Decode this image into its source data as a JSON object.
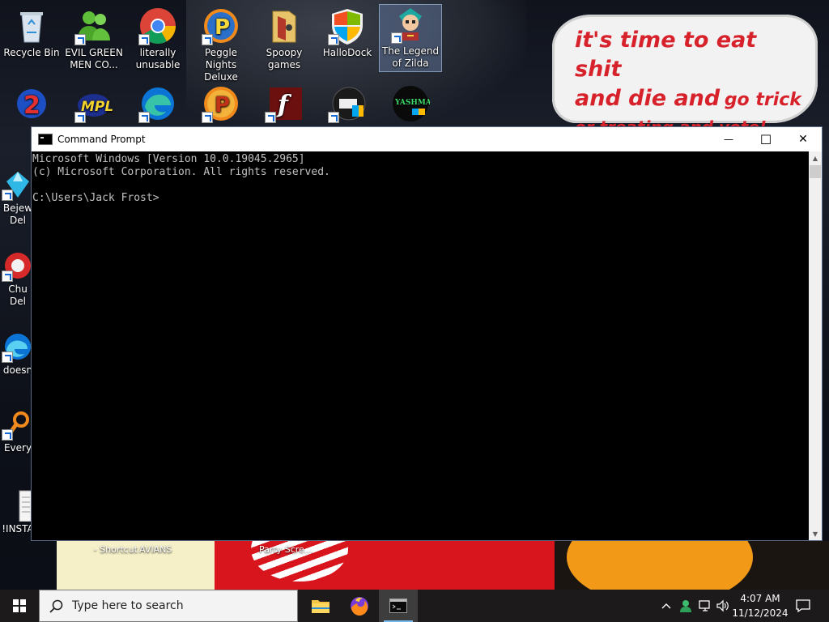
{
  "desktop": {
    "sign": {
      "line1": "it's time to eat shit",
      "line2a": "and die and",
      "line2b": "go trick",
      "line3": "or treating and vote!"
    },
    "icons_row1": [
      {
        "label": "Recycle Bin",
        "icon": "recycle-bin-icon"
      },
      {
        "label": "EVIL GREEN MEN CO...",
        "icon": "people-icon"
      },
      {
        "label": "literally unusable",
        "icon": "chrome-icon"
      },
      {
        "label": "Peggle Nights Deluxe",
        "icon": "peggle-icon"
      },
      {
        "label": "Spoopy games",
        "icon": "folder-icon"
      },
      {
        "label": "HalloDock",
        "icon": "windows-shield-icon"
      },
      {
        "label": "The Legend of Zilda",
        "icon": "game-character-icon"
      }
    ],
    "left_partial_icons": [
      {
        "label": "Bejew Del",
        "icon": "bejeweled-icon"
      },
      {
        "label": "Bejew Del",
        "icon": "bejeweled-icon"
      },
      {
        "label": "Chu Del",
        "icon": "game-icon"
      },
      {
        "label": "doesn",
        "icon": "edge-icon"
      },
      {
        "label": "Every",
        "icon": "search-icon"
      },
      {
        "label": "!INSTA",
        "icon": "document-icon"
      }
    ],
    "bottom_labels": [
      "- Shortcut",
      "AVIANS",
      "Party Scre..."
    ]
  },
  "window": {
    "title": "Command Prompt",
    "minimize": "—",
    "maximize": "☐",
    "close": "✕",
    "console_lines": [
      "Microsoft Windows [Version 10.0.19045.2965]",
      "(c) Microsoft Corporation. All rights reserved.",
      "",
      "C:\\Users\\Jack Frost>"
    ]
  },
  "taskbar": {
    "search_placeholder": "Type here to search",
    "time": "4:07 AM",
    "date": "11/12/2024",
    "apps": [
      "file-explorer-icon",
      "firefox-icon",
      "command-prompt-icon"
    ]
  },
  "colors": {
    "sign_text": "#d8222b",
    "taskbar_bg": "#1c1a1a",
    "console_text": "#c0c0c0"
  }
}
